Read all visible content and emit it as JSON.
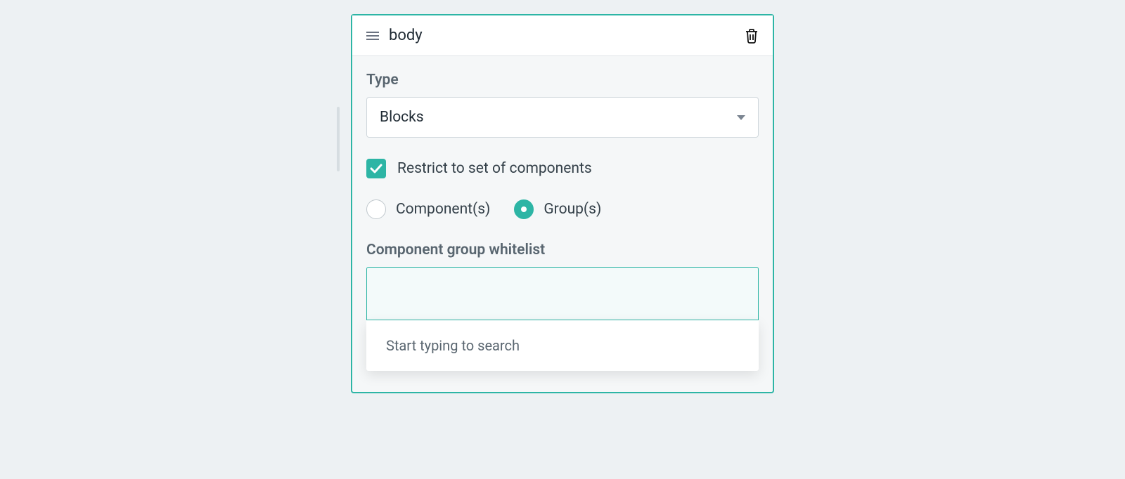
{
  "header": {
    "title": "body"
  },
  "form": {
    "type_label": "Type",
    "type_value": "Blocks",
    "restrict_label": "Restrict to set of components",
    "restrict_checked": true,
    "radio_components": "Component(s)",
    "radio_groups": "Group(s)",
    "radio_selected": "groups",
    "whitelist_label": "Component group whitelist",
    "search_placeholder": "Start typing to search"
  },
  "colors": {
    "accent": "#2db5a5"
  }
}
